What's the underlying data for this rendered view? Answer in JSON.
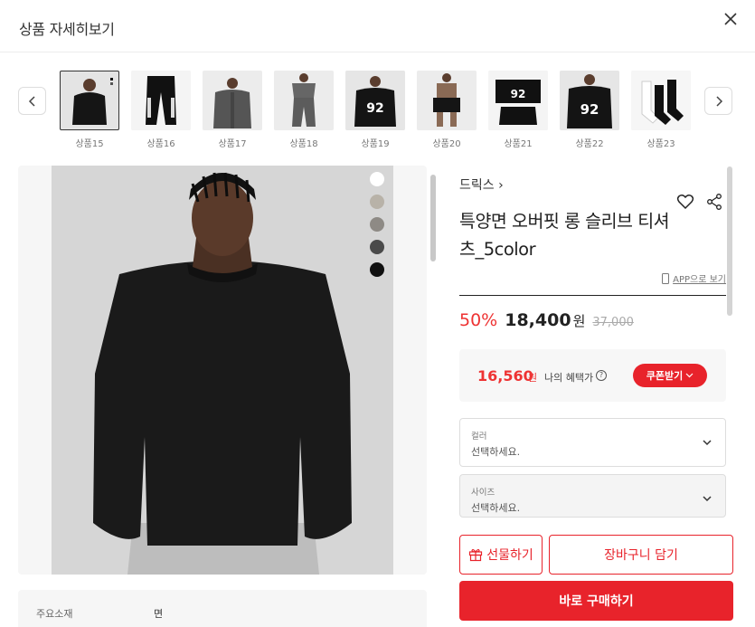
{
  "header": {
    "title": "상품 자세히보기"
  },
  "thumbnails": [
    {
      "label": "상품15",
      "selected": true
    },
    {
      "label": "상품16",
      "selected": false
    },
    {
      "label": "상품17",
      "selected": false
    },
    {
      "label": "상품18",
      "selected": false
    },
    {
      "label": "상품19",
      "selected": false
    },
    {
      "label": "상품20",
      "selected": false
    },
    {
      "label": "상품21",
      "selected": false
    },
    {
      "label": "상품22",
      "selected": false
    },
    {
      "label": "상품23",
      "selected": false
    }
  ],
  "swatches": [
    "#ffffff",
    "#b8b2a8",
    "#8e8a85",
    "#4a4a4a",
    "#111111"
  ],
  "specs": {
    "key": "주요소재",
    "value": "면"
  },
  "product": {
    "brand": "드릭스 ›",
    "name": "특양면 오버핏 롱 슬리브 티셔츠_5color",
    "app_link": "APP으로 보기",
    "discount": "50%",
    "price": "18,400",
    "price_unit": "원",
    "original_price": "37,000"
  },
  "benefit": {
    "price": "16,560",
    "unit": "원",
    "label": "나의 혜택가",
    "coupon_button": "쿠폰받기"
  },
  "options": {
    "color": {
      "label": "컬러",
      "value": "선택하세요."
    },
    "size": {
      "label": "사이즈",
      "value": "선택하세요."
    }
  },
  "actions": {
    "gift": "선물하기",
    "cart": "장바구니 담기",
    "buy": "바로 구매하기"
  },
  "colors": {
    "accent": "#e8232b",
    "discount": "#ee3333"
  }
}
